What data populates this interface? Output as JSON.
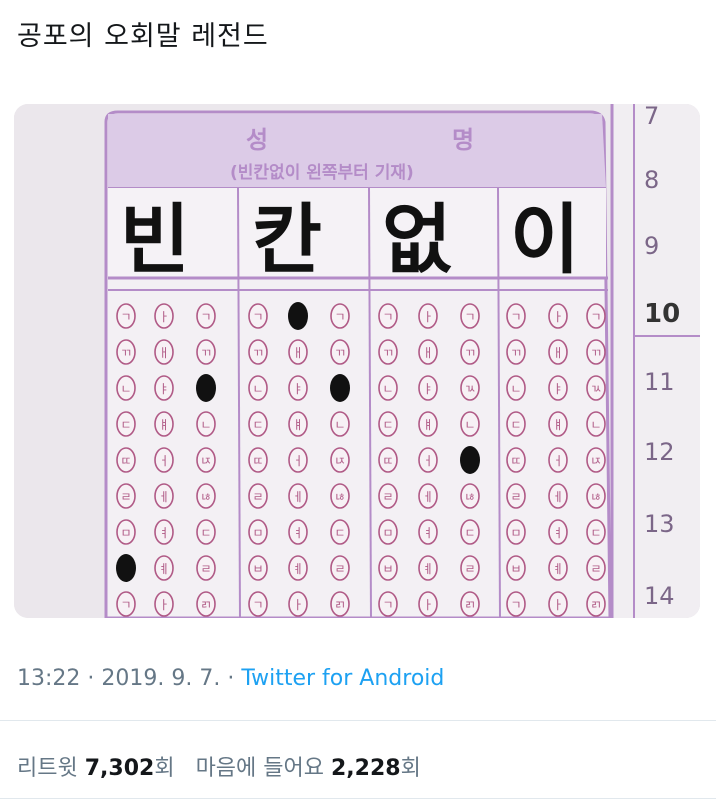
{
  "tweet": {
    "text": "공포의 오회말 레전드"
  },
  "photo": {
    "header_left": "성",
    "header_right": "명",
    "instruction": "(빈칸없이 왼쪽부터 기재)",
    "name_chars": [
      "빈",
      "칸",
      "없",
      "이"
    ],
    "row_numbers": [
      "7",
      "8",
      "9",
      "10",
      "11",
      "12",
      "13",
      "14"
    ],
    "consonants": [
      "ㄱ",
      "ㄲ",
      "ㄴ",
      "ㄷ",
      "ㄸ",
      "ㄹ",
      "ㅁ",
      "ㅂ"
    ],
    "vowels": [
      "ㅏ",
      "ㅐ",
      "ㅑ",
      "ㅒ",
      "ㅓ",
      "ㅔ",
      "ㅕ",
      "ㅖ"
    ],
    "finals": [
      "ㄱ",
      "ㄲ",
      "ㄳ",
      "ㄴ",
      "ㄵ",
      "ㄶ",
      "ㄷ",
      "ㄹ",
      "ㄺ"
    ]
  },
  "meta": {
    "time": "13:22",
    "sep1": " · ",
    "date": "2019. 9. 7.",
    "sep2": " · ",
    "via": "Twitter for Android"
  },
  "stats": {
    "retweets_label": "리트윗",
    "retweets_count": "7,302",
    "retweets_unit": "회",
    "likes_label": "마음에 들어요",
    "likes_count": "2,228",
    "likes_unit": "회"
  },
  "colors": {
    "sheet_purple": "#b48cc8",
    "header_fill": "#d9c6e6",
    "bubble": "#b05a86",
    "ink": "#111111",
    "link": "#1da1f2",
    "muted": "#657786"
  }
}
